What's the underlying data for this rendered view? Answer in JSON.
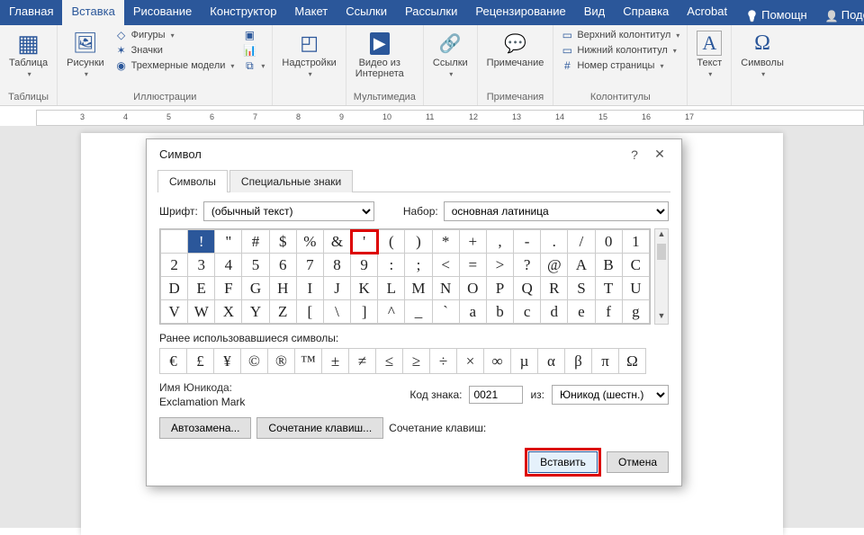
{
  "tabs": {
    "items": [
      "Главная",
      "Вставка",
      "Рисование",
      "Конструктор",
      "Макет",
      "Ссылки",
      "Рассылки",
      "Рецензирование",
      "Вид",
      "Справка",
      "Acrobat"
    ],
    "active_index": 1,
    "help": "Помощн",
    "share": "Поделиться"
  },
  "ribbon": {
    "tables": {
      "label": "Таблицы",
      "btn": "Таблица"
    },
    "illus": {
      "label": "Иллюстрации",
      "pic": "Рисунки",
      "shapes": "Фигуры",
      "icons": "Значки",
      "models": "Трехмерные модели"
    },
    "addins": {
      "label": "",
      "btn": "Надстройки"
    },
    "media": {
      "label": "Мультимедиа",
      "btn": "Видео из\nИнтернета"
    },
    "links": {
      "label": "",
      "btn": "Ссылки"
    },
    "comments": {
      "label": "Примечания",
      "btn": "Примечание"
    },
    "headers": {
      "label": "Колонтитулы",
      "top": "Верхний колонтитул",
      "bottom": "Нижний колонтитул",
      "page": "Номер страницы"
    },
    "text": {
      "label": "",
      "btn": "Текст"
    },
    "symbols": {
      "label": "",
      "btn": "Символы"
    }
  },
  "dialog": {
    "title": "Символ",
    "tab_symbols": "Символы",
    "tab_special": "Специальные знаки",
    "font_label": "Шрифт:",
    "font_value": "(обычный текст)",
    "set_label": "Набор:",
    "set_value": "основная латиница",
    "grid": [
      [
        " ",
        "!",
        "\"",
        "#",
        "$",
        "%",
        "&",
        "'",
        "(",
        ")",
        "*",
        "+",
        ",",
        "-",
        ".",
        "/",
        "0",
        "1"
      ],
      [
        "2",
        "3",
        "4",
        "5",
        "6",
        "7",
        "8",
        "9",
        ":",
        ";",
        "<",
        "=",
        ">",
        "?",
        "@",
        "A",
        "B",
        "C"
      ],
      [
        "D",
        "E",
        "F",
        "G",
        "H",
        "I",
        "J",
        "K",
        "L",
        "M",
        "N",
        "O",
        "P",
        "Q",
        "R",
        "S",
        "T",
        "U"
      ],
      [
        "V",
        "W",
        "X",
        "Y",
        "Z",
        "[",
        "\\",
        "]",
        "^",
        "_",
        "`",
        "a",
        "b",
        "c",
        "d",
        "e",
        "f",
        "g"
      ]
    ],
    "selected_rc": [
      0,
      1
    ],
    "highlight_rc": [
      0,
      7
    ],
    "recent_label": "Ранее использовавшиеся символы:",
    "recent": [
      "€",
      "£",
      "¥",
      "©",
      "®",
      "™",
      "±",
      "≠",
      "≤",
      "≥",
      "÷",
      "×",
      "∞",
      "µ",
      "α",
      "β",
      "π",
      "Ω"
    ],
    "unicode_name_label": "Имя Юникода:",
    "unicode_name": "Exclamation Mark",
    "code_label": "Код знака:",
    "code_value": "0021",
    "from_label": "из:",
    "from_value": "Юникод (шестн.)",
    "btn_autocorrect": "Автозамена...",
    "btn_shortcut": "Сочетание клавиш...",
    "shortcut_label": "Сочетание клавиш:",
    "btn_insert": "Вставить",
    "btn_cancel": "Отмена"
  }
}
